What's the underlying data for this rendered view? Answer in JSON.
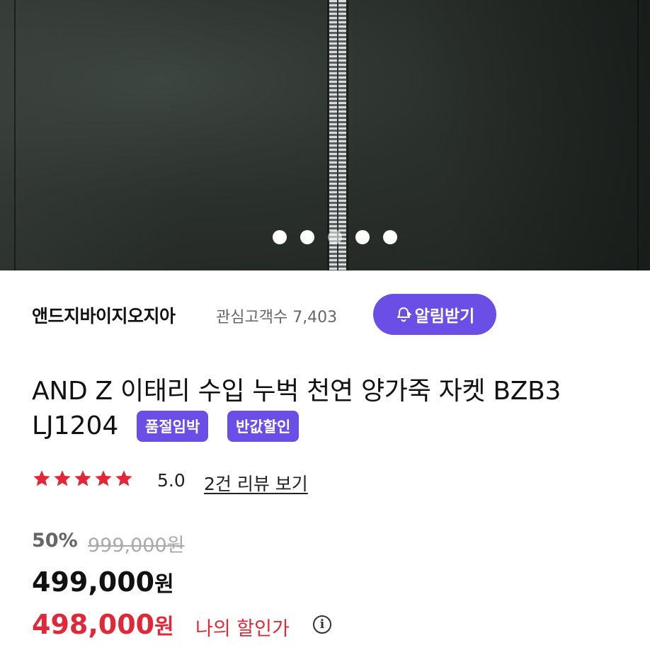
{
  "gallery": {
    "slide_count": 5,
    "active_index": 2
  },
  "store": {
    "name": "앤드지바이지오지아",
    "fans_label": "관심고객수 7,403",
    "alarm_button": "알림받기"
  },
  "product": {
    "title_line1": "AND Z 이태리 수입 누벅 천연 양가죽 자켓 BZB3",
    "title_line2": "LJ1204",
    "badges": [
      "품절임박",
      "반값할인"
    ]
  },
  "rating": {
    "stars": 5,
    "score": "5.0",
    "reviews_link": "2건 리뷰 보기"
  },
  "price": {
    "discount_rate": "50%",
    "original": "999,000원",
    "sale_amount": "499,000",
    "sale_unit": "원",
    "my_amount": "498,000",
    "my_unit": "원",
    "my_label": "나의 할인가"
  },
  "colors": {
    "accent": "#6b4ee6",
    "price_red": "#e02838",
    "star": "#e02838"
  },
  "icons": {
    "alarm": "bell-plus-icon",
    "info": "info-icon",
    "star": "star-icon"
  }
}
